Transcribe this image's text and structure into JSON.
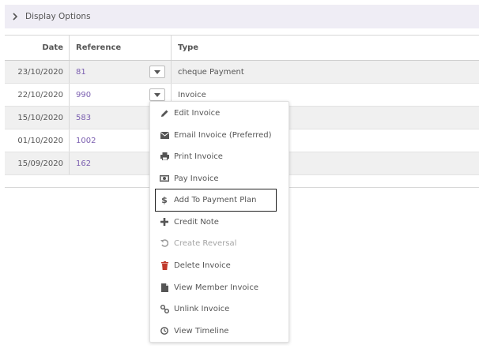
{
  "display_options": {
    "label": "Display Options"
  },
  "table": {
    "headers": {
      "date": "Date",
      "reference": "Reference",
      "type": "Type"
    },
    "rows": [
      {
        "date": "23/10/2020",
        "reference": "81",
        "type": "cheque Payment"
      },
      {
        "date": "22/10/2020",
        "reference": "990",
        "type": "Invoice"
      },
      {
        "date": "15/10/2020",
        "reference": "583",
        "type": ""
      },
      {
        "date": "01/10/2020",
        "reference": "1002",
        "type": ""
      },
      {
        "date": "15/09/2020",
        "reference": "162",
        "type": ""
      }
    ]
  },
  "menu": {
    "items": [
      {
        "label": "Edit Invoice",
        "icon": "pencil-icon"
      },
      {
        "label": "Email Invoice (Preferred)",
        "icon": "envelope-icon"
      },
      {
        "label": "Print Invoice",
        "icon": "printer-icon"
      },
      {
        "label": "Pay Invoice",
        "icon": "money-icon"
      },
      {
        "label": "Add To Payment Plan",
        "icon": "dollar-icon"
      },
      {
        "label": "Credit Note",
        "icon": "plus-icon"
      },
      {
        "label": "Create Reversal",
        "icon": "undo-icon"
      },
      {
        "label": "Delete Invoice",
        "icon": "trash-icon"
      },
      {
        "label": "View Member Invoice",
        "icon": "file-icon"
      },
      {
        "label": "Unlink Invoice",
        "icon": "unlink-icon"
      },
      {
        "label": "View Timeline",
        "icon": "clock-icon"
      }
    ]
  },
  "colors": {
    "link": "#7b5fb0",
    "delete_icon": "#c0392b",
    "banner_bg": "#efedf5"
  }
}
